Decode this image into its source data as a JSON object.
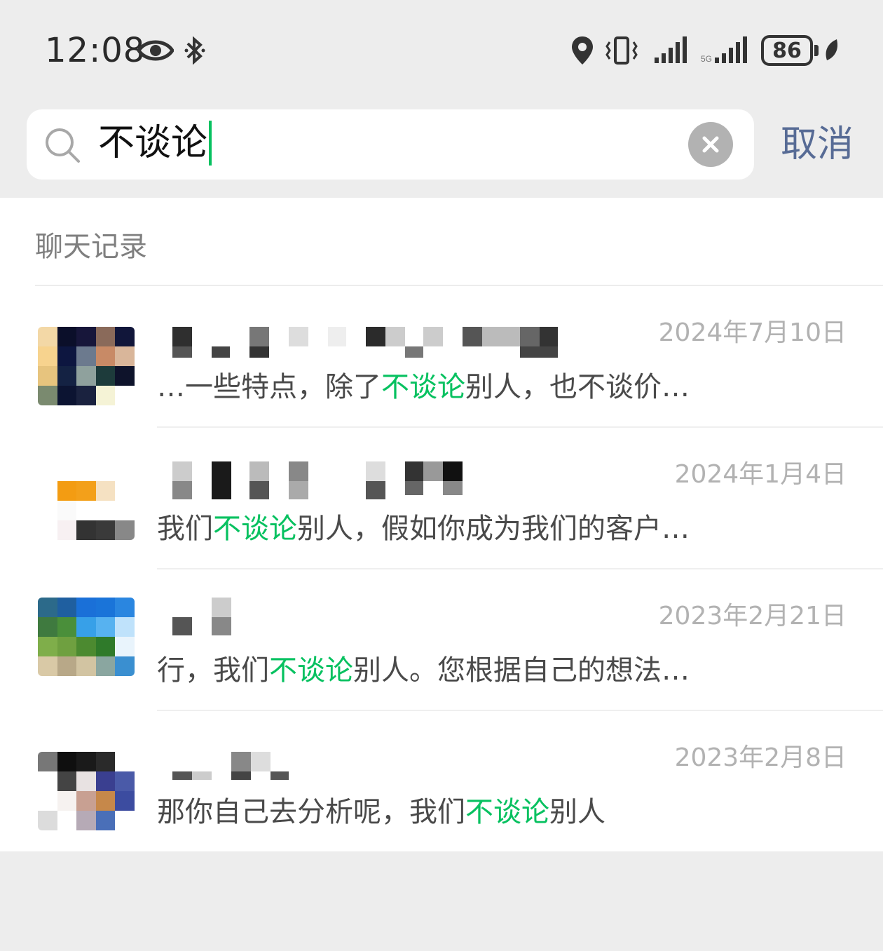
{
  "status_bar": {
    "time": "12:08",
    "battery": "86",
    "icons": [
      "eye-icon",
      "bluetooth-icon",
      "location-icon",
      "vibrate-icon",
      "signal-icon",
      "signal-icon",
      "battery-icon",
      "charging-leaf-icon"
    ]
  },
  "search": {
    "query": "不谈论",
    "clear_icon": "clear-circle-icon",
    "cancel_label": "取消"
  },
  "section": {
    "title": "聊天记录"
  },
  "theme": {
    "highlight": "#07c160",
    "link": "#576b95",
    "muted": "#b2b2b2"
  },
  "results": [
    {
      "date": "2024年7月10日",
      "pre": "…一些特点，除了",
      "match": "不谈论",
      "post": "别人，也不谈价…"
    },
    {
      "date": "2024年1月4日",
      "pre": "我们",
      "match": "不谈论",
      "post": "别人，假如你成为我们的客户…"
    },
    {
      "date": "2023年2月21日",
      "pre": "行，我们",
      "match": "不谈论",
      "post": "别人。您根据自己的想法…"
    },
    {
      "date": "2023年2月8日",
      "pre": "那你自己去分析呢，我们",
      "match": "不谈论",
      "post": "别人"
    }
  ]
}
